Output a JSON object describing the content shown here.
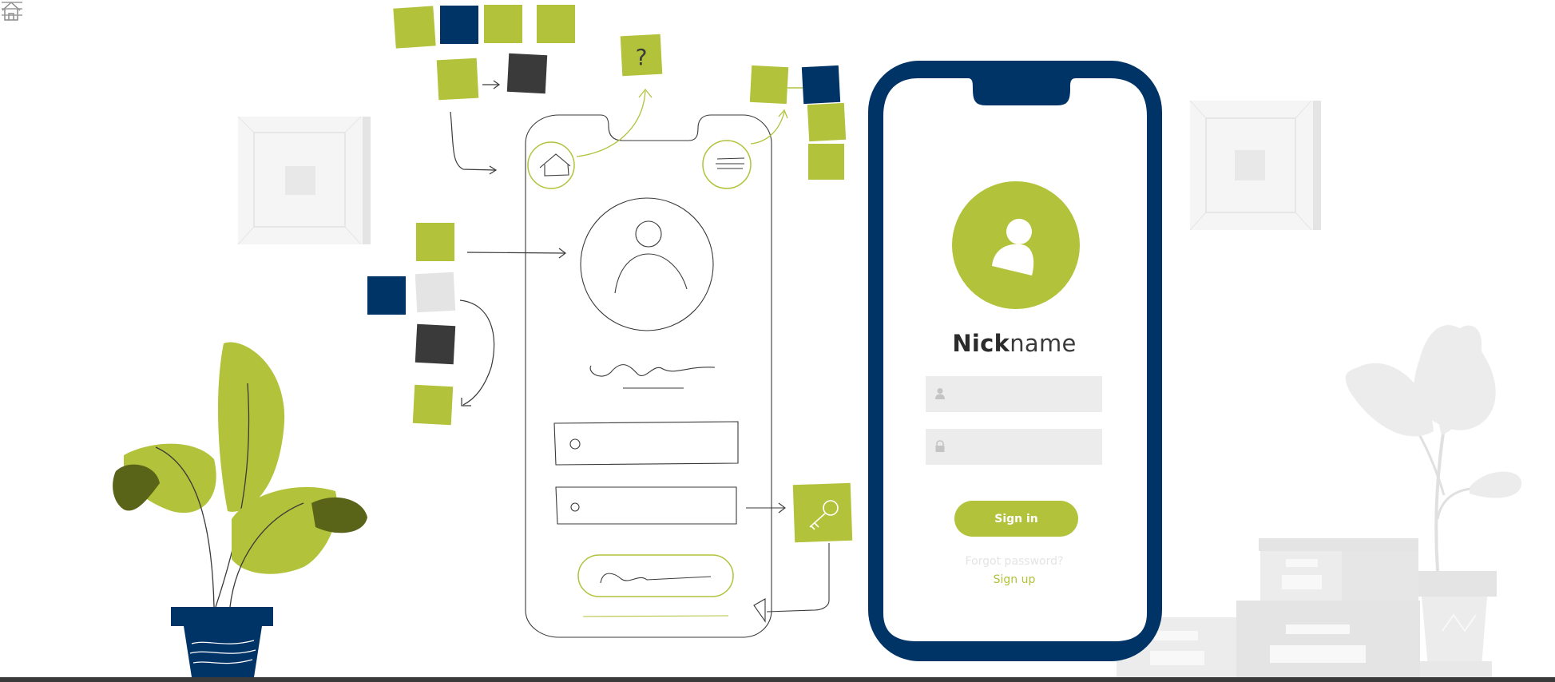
{
  "profile": {
    "nickname_bold": "Nick",
    "nickname_rest": "name"
  },
  "form": {
    "username_value": "",
    "password_value": ""
  },
  "actions": {
    "sign_in_label": "Sign in",
    "forgot_label": "Forgot password?",
    "sign_up_label": "Sign up"
  },
  "icons": [
    "home-icon",
    "menu-icon",
    "user-icon",
    "lock-icon",
    "key-icon",
    "question-icon"
  ],
  "colors": {
    "accent": "#b2c23a",
    "navy": "#003366",
    "charcoal": "#3a3a3a",
    "dark_leaf": "#5a6419",
    "light_gray": "#ececec"
  }
}
